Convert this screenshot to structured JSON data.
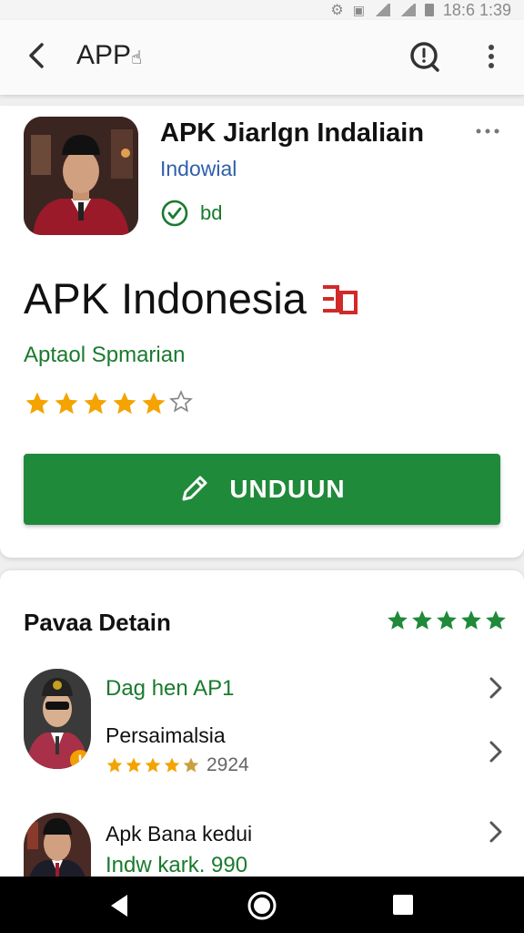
{
  "status": {
    "time": "18:6 1:39"
  },
  "appbar": {
    "title": "APP",
    "cursor": "☝"
  },
  "app": {
    "name": "APK Jiarlgn Indaliain",
    "developer": "Indowial",
    "verified_label": "bd",
    "title": "APK Indonesia",
    "category": "Aptaol Spmarian",
    "rating_stars": 5,
    "rating_max": 6,
    "install_label": "UNDUUN"
  },
  "colors": {
    "accent_green": "#1f8a3a",
    "star": "#f4a300",
    "link_blue": "#2f5faa",
    "tag_red": "#d12a2a"
  },
  "details": {
    "title": "Pavaa Detain",
    "stars": 5,
    "items": [
      {
        "title": "Dag hen AP1",
        "subtitle": "Persaimalsia",
        "rating": 4.5,
        "year": "2924"
      },
      {
        "title": "Indw kark. 990",
        "subtitle": "Apk Bana kedui"
      }
    ]
  },
  "icons": [
    "back-arrow-icon",
    "search-icon",
    "more-vert-icon",
    "verified-check-icon",
    "tag-icon",
    "star-icon",
    "pencil-icon",
    "chevron-right-icon",
    "nav-back-icon",
    "nav-home-icon",
    "nav-recents-icon"
  ]
}
